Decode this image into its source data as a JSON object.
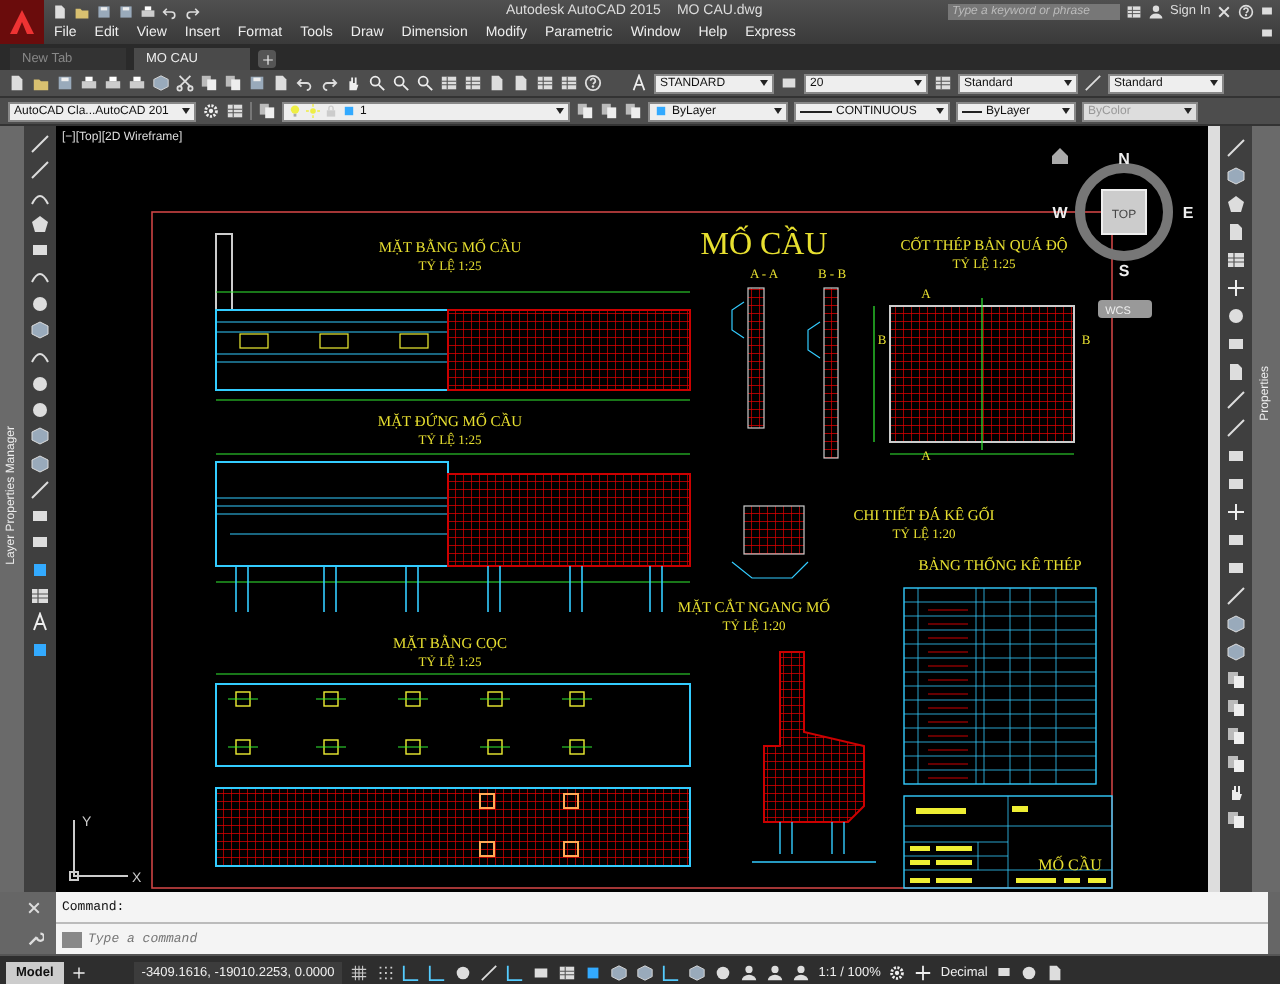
{
  "title_bar": {
    "app_name": "Autodesk AutoCAD 2015",
    "file_name": "MO CAU.dwg",
    "search_placeholder": "Type a keyword or phrase",
    "sign_in": "Sign In"
  },
  "menu": [
    "File",
    "Edit",
    "View",
    "Insert",
    "Format",
    "Tools",
    "Draw",
    "Dimension",
    "Modify",
    "Parametric",
    "Window",
    "Help",
    "Express"
  ],
  "tabs": [
    {
      "label": "New Tab",
      "selected": false
    },
    {
      "label": "MO CAU",
      "selected": true
    }
  ],
  "style_dropdowns": [
    "STANDARD",
    "20",
    "Standard",
    "Standard"
  ],
  "properties_toolbar": {
    "workspace": "AutoCAD Cla...AutoCAD 201",
    "layer": "1",
    "color_control": "ByLayer",
    "linetype": "CONTINUOUS",
    "lineweight": "ByLayer",
    "plot_style": {
      "value": "ByColor",
      "disabled": true
    }
  },
  "palettes": {
    "left": "Layer Properties Manager",
    "right": "Properties"
  },
  "viewport": {
    "label": "[−][Top][2D Wireframe]",
    "viewcube": {
      "face": "TOP",
      "north": "N",
      "south": "S",
      "east": "E",
      "west": "W",
      "ucs_menu": "WCS"
    },
    "ucs_axes": {
      "x": "X",
      "y": "Y"
    },
    "drawing_labels": [
      {
        "text": "MẶT BẰNG MỐ CẦU",
        "kind": "title"
      },
      {
        "text": "TỶ LỆ 1:25",
        "kind": "scale"
      },
      {
        "text": "MẶT ĐỨNG MỐ CẦU",
        "kind": "title"
      },
      {
        "text": "TỶ LỆ 1:25",
        "kind": "scale"
      },
      {
        "text": "MẶT BẰNG CỌC",
        "kind": "title"
      },
      {
        "text": "TỶ LỆ 1:25",
        "kind": "scale"
      },
      {
        "text": "MỐ CẦU",
        "kind": "heading"
      },
      {
        "text": "A - A",
        "kind": "section"
      },
      {
        "text": "B - B",
        "kind": "section"
      },
      {
        "text": "CỐT THÉP BẢN QUÁ ĐỘ",
        "kind": "title"
      },
      {
        "text": "TỶ LỆ 1:25",
        "kind": "scale"
      },
      {
        "text": "A",
        "kind": "letter"
      },
      {
        "text": "B",
        "kind": "letter"
      },
      {
        "text": "B",
        "kind": "letter"
      },
      {
        "text": "A",
        "kind": "letter"
      },
      {
        "text": "CHI TIẾT ĐÁ KÊ GỐI",
        "kind": "title"
      },
      {
        "text": "TỶ LỆ 1:20",
        "kind": "scale"
      },
      {
        "text": "BẢNG THỐNG KÊ THÉP",
        "kind": "title"
      },
      {
        "text": "MẶT CẮT NGANG MỐ",
        "kind": "title"
      },
      {
        "text": "TỶ LỆ 1:20",
        "kind": "scale"
      },
      {
        "text": "MỐ CẦU",
        "kind": "block"
      }
    ]
  },
  "command_line": {
    "history": "Command:",
    "placeholder": "Type a command"
  },
  "status_bar": {
    "layout_tabs": [
      {
        "label": "Model",
        "selected": true
      }
    ],
    "coordinates": "-3409.1616, -19010.2253, 0.0000",
    "annotation_scale": "1:1 / 100%",
    "units": "Decimal"
  }
}
